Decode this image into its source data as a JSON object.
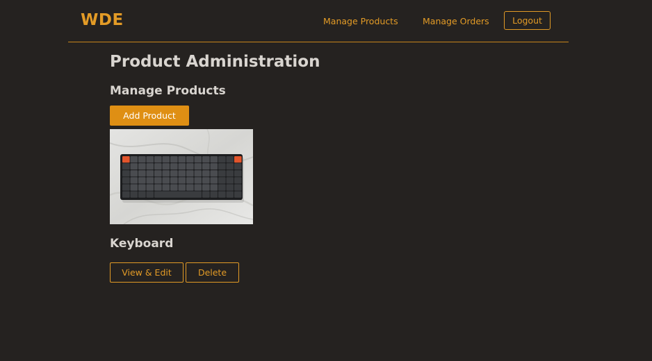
{
  "header": {
    "logo": "WDE",
    "nav": {
      "manage_products": "Manage Products",
      "manage_orders": "Manage Orders",
      "logout": "Logout"
    }
  },
  "main": {
    "title": "Product Administration",
    "section_title": "Manage Products",
    "add_product_label": "Add Product",
    "products": [
      {
        "name": "Keyboard",
        "image_alt": "keyboard-on-marble-photo",
        "view_edit_label": "View & Edit",
        "delete_label": "Delete"
      }
    ]
  },
  "colors": {
    "background": "#252220",
    "accent": "#e39b26",
    "button_fill": "#df8f14",
    "heading_text": "#d9d5d0"
  }
}
